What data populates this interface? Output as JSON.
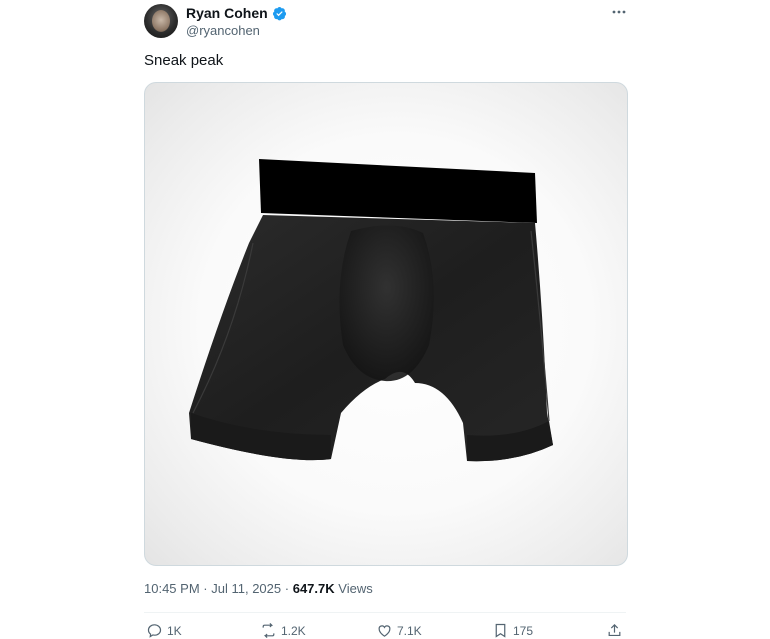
{
  "user": {
    "display_name": "Ryan Cohen",
    "handle": "@ryancohen",
    "verified": true,
    "verified_color": "#1d9bf0"
  },
  "tweet": {
    "text": "Sneak peak",
    "media_icon": "black-boxer-briefs-photo",
    "time": "10:45 PM",
    "separator": "·",
    "date": "Jul 11, 2025",
    "views_count": "647.7K",
    "views_label": "Views"
  },
  "actions": {
    "replies": "1K",
    "reposts": "1.2K",
    "likes": "7.1K",
    "bookmarks": "175"
  },
  "icons": {
    "more": "more-horizontal-icon",
    "reply": "reply-icon",
    "repost": "repost-icon",
    "like": "heart-icon",
    "bookmark": "bookmark-icon",
    "share": "share-icon"
  }
}
